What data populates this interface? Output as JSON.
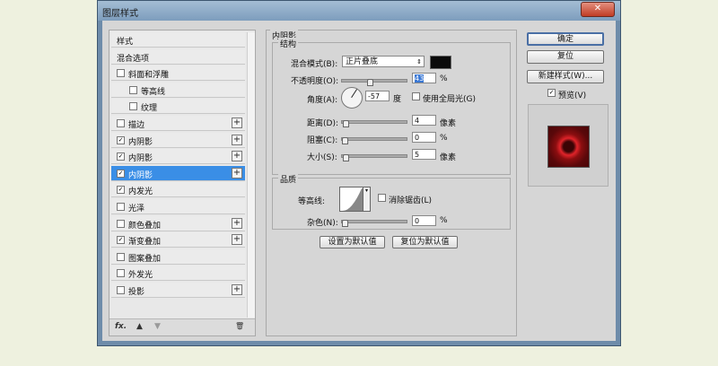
{
  "window": {
    "title": "图层样式",
    "close_glyph": "✕"
  },
  "sidebar": {
    "items": [
      {
        "label": "样式",
        "check": false,
        "checked": false,
        "plus": false,
        "indent": false,
        "selected": false
      },
      {
        "label": "混合选项",
        "check": false,
        "checked": false,
        "plus": false,
        "indent": false,
        "selected": false
      },
      {
        "label": "斜面和浮雕",
        "check": true,
        "checked": false,
        "plus": false,
        "indent": false,
        "selected": false
      },
      {
        "label": "等高线",
        "check": true,
        "checked": false,
        "plus": false,
        "indent": true,
        "selected": false
      },
      {
        "label": "纹理",
        "check": true,
        "checked": false,
        "plus": false,
        "indent": true,
        "selected": false
      },
      {
        "label": "描边",
        "check": true,
        "checked": false,
        "plus": true,
        "indent": false,
        "selected": false
      },
      {
        "label": "内阴影",
        "check": true,
        "checked": true,
        "plus": true,
        "indent": false,
        "selected": false
      },
      {
        "label": "内阴影",
        "check": true,
        "checked": true,
        "plus": true,
        "indent": false,
        "selected": false
      },
      {
        "label": "内阴影",
        "check": true,
        "checked": true,
        "plus": true,
        "indent": false,
        "selected": true
      },
      {
        "label": "内发光",
        "check": true,
        "checked": true,
        "plus": false,
        "indent": false,
        "selected": false
      },
      {
        "label": "光泽",
        "check": true,
        "checked": false,
        "plus": false,
        "indent": false,
        "selected": false
      },
      {
        "label": "颜色叠加",
        "check": true,
        "checked": false,
        "plus": true,
        "indent": false,
        "selected": false
      },
      {
        "label": "渐变叠加",
        "check": true,
        "checked": true,
        "plus": true,
        "indent": false,
        "selected": false
      },
      {
        "label": "图案叠加",
        "check": true,
        "checked": false,
        "plus": false,
        "indent": false,
        "selected": false
      },
      {
        "label": "外发光",
        "check": true,
        "checked": false,
        "plus": false,
        "indent": false,
        "selected": false
      },
      {
        "label": "投影",
        "check": true,
        "checked": false,
        "plus": true,
        "indent": false,
        "selected": false
      }
    ],
    "footer": {
      "fx": "fx.",
      "up": "▲",
      "down": "▼",
      "trash": "🗑"
    }
  },
  "panel": {
    "section_title": "内阴影",
    "structure": {
      "title": "结构",
      "blend_label": "混合模式(B):",
      "blend_value": "正片叠底",
      "color_swatch": "#0a0a0a",
      "opacity_label": "不透明度(O):",
      "opacity_value": "43",
      "opacity_slider": 0.43,
      "opacity_unit": "%",
      "angle_label": "角度(A):",
      "angle_value": "-57",
      "angle_unit": "度",
      "global_light": "使用全局光(G)",
      "distance_label": "距离(D):",
      "distance_value": "4",
      "distance_unit": "像素",
      "distance_slider": 0.02,
      "choke_label": "阻塞(C):",
      "choke_value": "0",
      "choke_unit": "%",
      "choke_slider": 0.0,
      "size_label": "大小(S):",
      "size_value": "5",
      "size_unit": "像素",
      "size_slider": 0.02
    },
    "quality": {
      "title": "品质",
      "contour_label": "等高线:",
      "antialias": "消除锯齿(L)",
      "noise_label": "杂色(N):",
      "noise_value": "0",
      "noise_unit": "%",
      "noise_slider": 0.0
    },
    "set_default": "设置为默认值",
    "reset_default": "复位为默认值"
  },
  "buttons": {
    "ok": "确定",
    "reset": "复位",
    "new_style": "新建样式(W)...",
    "preview": "预览(V)"
  },
  "colors": {
    "selected": "#3a8ee6",
    "preview_red": "#8b0e10"
  }
}
